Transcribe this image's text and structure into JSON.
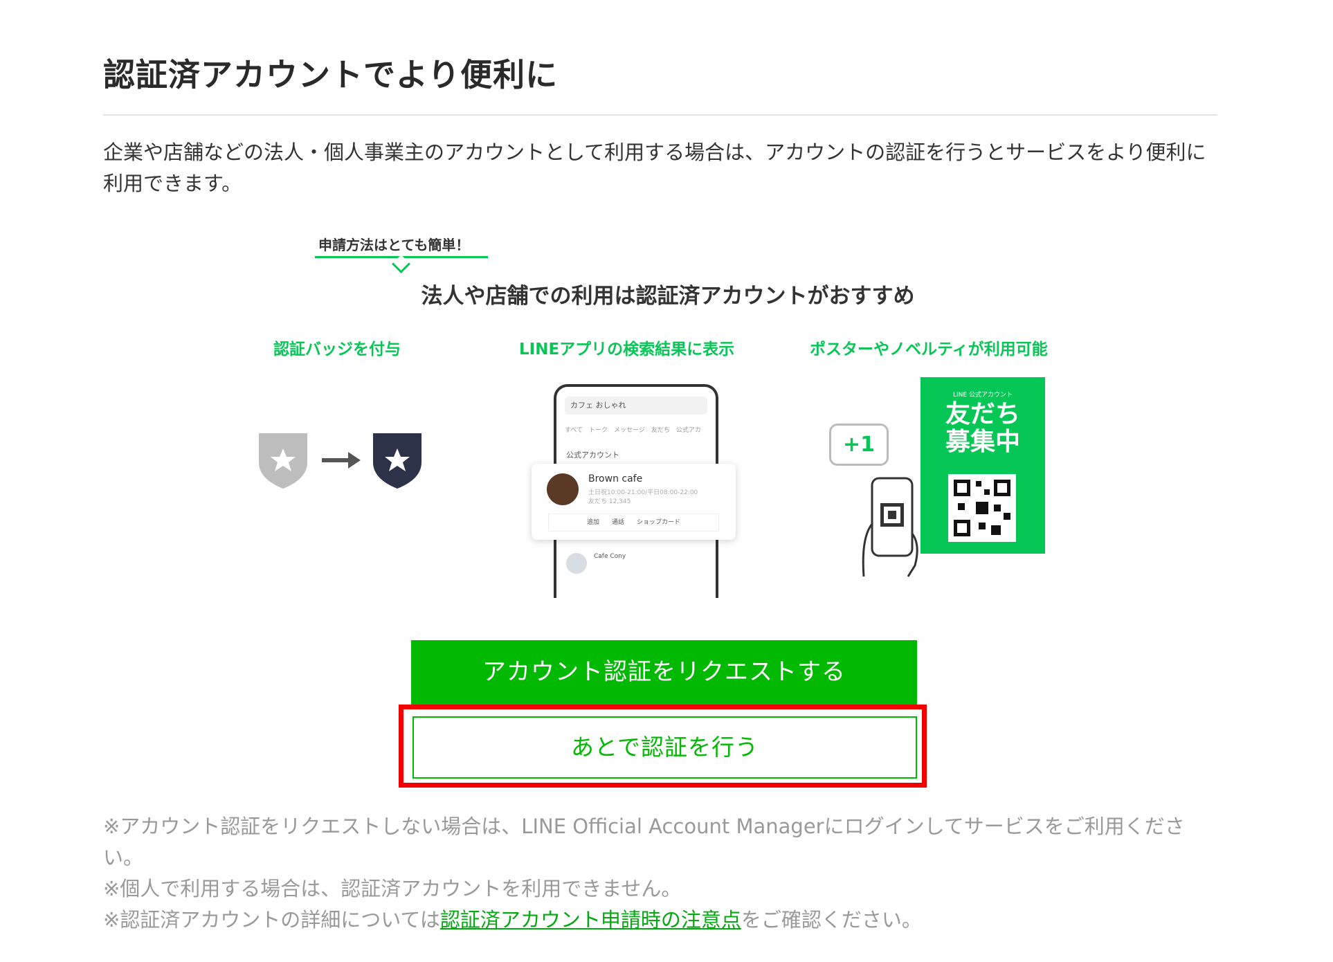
{
  "page": {
    "title": "認証済アカウントでより便利に",
    "intro": "企業や店舗などの法人・個人事業主のアカウントとして利用する場合は、アカウントの認証を行うとサービスをより便利に利用できます。"
  },
  "promo": {
    "tag": "申請方法はとても簡単！",
    "headline": "法人や店舗での利用は認証済アカウントがおすすめ",
    "features": [
      {
        "label": "認証バッジを付与"
      },
      {
        "label": "LINEアプリの検索結果に表示"
      },
      {
        "label": "ポスターやノベルティが利用可能"
      }
    ],
    "phone": {
      "search": "カフェ おしゃれ",
      "tabs": "すべて　トーク　メッセージ　友だち　公式アカ",
      "section": "公式アカウント",
      "card_name": "Brown cafe",
      "card_sub_1": "土日祝10:00-21:00/平日08:00-22:00",
      "card_sub_2": "友だち 12,345",
      "card_actions": "追加　　通話　　ショップカード",
      "row_name": "Cafe Cony"
    },
    "poster": {
      "small": "LINE 公式アカウント",
      "big_1": "友だち",
      "big_2": "募集中",
      "plus": "+1"
    }
  },
  "buttons": {
    "request": "アカウント認証をリクエストする",
    "later": "あとで認証を行う"
  },
  "notes": {
    "note1": "※アカウント認証をリクエストしない場合は、LINE Official Account Managerにログインしてサービスをご利用ください。",
    "note2": "※個人で利用する場合は、認証済アカウントを利用できません。",
    "note3_prefix": "※認証済アカウントの詳細については",
    "note3_link": "認証済アカウント申請時の注意点",
    "note3_suffix": "をご確認ください。"
  },
  "colors": {
    "brand_green": "#00b900",
    "highlight_red": "#f20000"
  }
}
